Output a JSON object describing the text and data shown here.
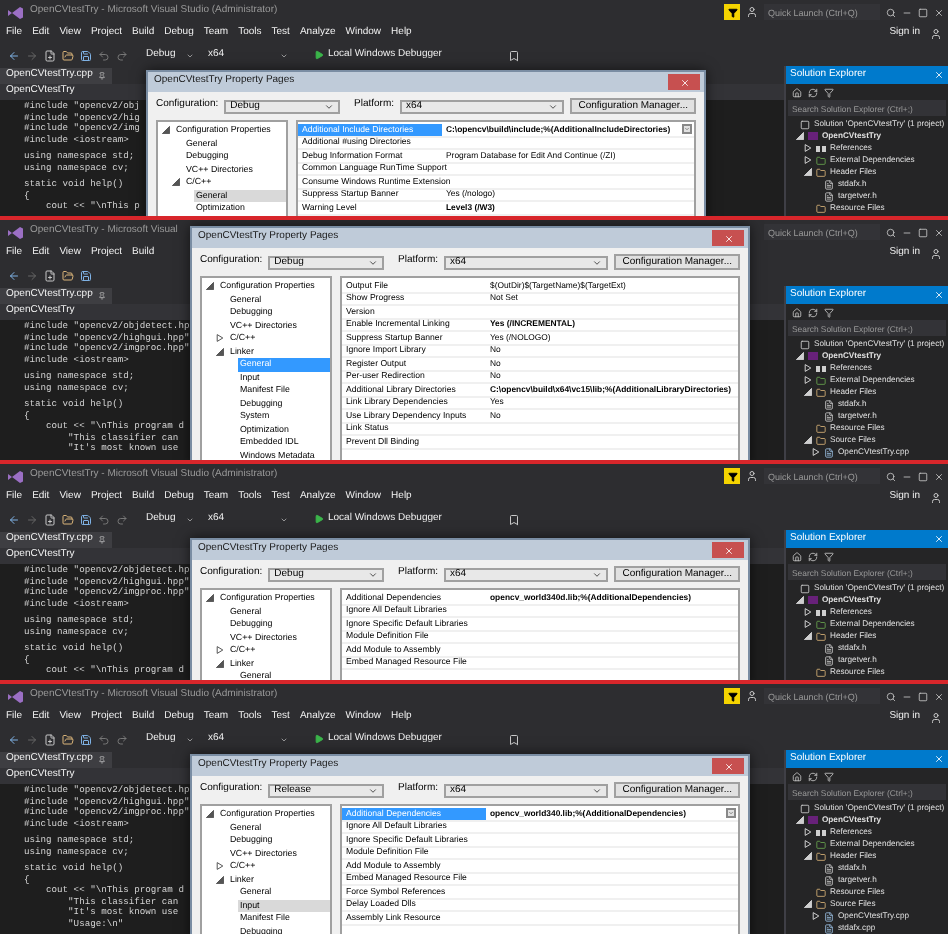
{
  "panels": [
    {
      "title": "OpenCVtestTry - Microsoft Visual Studio (Administrator)",
      "quick_launch": {
        "placeholder": "Quick Launch (Ctrl+Q)"
      },
      "menu": [
        "File",
        "Edit",
        "View",
        "Project",
        "Build",
        "Debug",
        "Team",
        "Tools",
        "Test",
        "Analyze",
        "Window",
        "Help"
      ],
      "sign_in": "Sign in",
      "toolbar": {
        "configuration": "Debug",
        "platform": "x64",
        "debugger": "Local Windows Debugger"
      },
      "editor": {
        "tab": "OpenCVtestTry.cpp",
        "scope": "OpenCVtestTry",
        "code_blocks": [
          [
            "#include \"opencv2/obj",
            "#include \"opencv2/hig",
            "#include \"opencv2/img",
            "#include <iostream>"
          ],
          [
            "using namespace std;",
            "using namespace cv;"
          ],
          [
            "static void help()",
            "{",
            "    cout << \"\\nThis p"
          ]
        ]
      },
      "solution_explorer": {
        "title": "Solution Explorer",
        "search": {
          "placeholder": "Search Solution Explorer (Ctrl+;)"
        },
        "tree": [
          {
            "label": "Solution 'OpenCVtestTry' (1 project)",
            "kind": "solution",
            "children": [
              {
                "label": "OpenCVtestTry",
                "kind": "project",
                "expanded": true,
                "children": [
                  {
                    "label": "References",
                    "kind": "references",
                    "expanded": false
                  },
                  {
                    "label": "External Dependencies",
                    "kind": "dependencies",
                    "expanded": false
                  },
                  {
                    "label": "Header Files",
                    "kind": "folder",
                    "expanded": true,
                    "children": [
                      {
                        "label": "stdafx.h",
                        "kind": "file"
                      },
                      {
                        "label": "targetver.h",
                        "kind": "file"
                      }
                    ]
                  },
                  {
                    "label": "Resource Files",
                    "kind": "folder"
                  }
                ]
              }
            ]
          }
        ]
      },
      "dialog": {
        "title": "OpenCVtestTry Property Pages",
        "configuration_label": "Configuration:",
        "configuration": "Debug",
        "platform_label": "Platform:",
        "platform": "x64",
        "manager_button": "Configuration Manager...",
        "tree_focused": false,
        "tree": [
          {
            "label": "Configuration Properties",
            "expanded": true,
            "selected": false,
            "children": [
              {
                "label": "General",
                "selected": false
              },
              {
                "label": "Debugging",
                "selected": false
              },
              {
                "label": "VC++ Directories",
                "selected": false
              },
              {
                "label": "C/C++",
                "expanded": true,
                "selected": false,
                "children": [
                  {
                    "label": "General",
                    "selected": true
                  },
                  {
                    "label": "Optimization",
                    "selected": false
                  }
                ]
              }
            ]
          }
        ],
        "properties": [
          {
            "name": "Additional Include Directories",
            "value": "C:\\opencv\\build\\include;%(AdditionalIncludeDirectories)",
            "bold": true,
            "selected": true
          },
          {
            "name": "Additional #using Directories",
            "selected": false
          },
          {
            "name": "Debug Information Format",
            "value": "Program Database for Edit And Continue (/ZI)",
            "bold": false,
            "selected": false
          },
          {
            "name": "Common Language RunTime Support",
            "selected": false
          },
          {
            "name": "Consume Windows Runtime Extension",
            "selected": false
          },
          {
            "name": "Suppress Startup Banner",
            "value": "Yes (/nologo)",
            "bold": false,
            "selected": false
          },
          {
            "name": "Warning Level",
            "value": "Level3 (/W3)",
            "bold": true,
            "selected": false
          }
        ]
      }
    },
    {
      "title": "OpenCVtestTry - Microsoft Visual",
      "quick_launch": {
        "placeholder": "Quick Launch (Ctrl+Q)"
      },
      "menu": [
        "File",
        "Edit",
        "View",
        "Project",
        "Build"
      ],
      "sign_in": "Sign in",
      "editor": {
        "tab": "OpenCVtestTry.cpp",
        "scope": "OpenCVtestTry",
        "code_blocks": [
          [
            "#include \"opencv2/objdetect.hp",
            "#include \"opencv2/highgui.hpp\"",
            "#include \"opencv2/imgproc.hpp\"",
            "#include <iostream>"
          ],
          [
            "using namespace std;",
            "using namespace cv;"
          ],
          [
            "static void help()",
            "{",
            "    cout << \"\\nThis program d",
            "        \"This classifier can",
            "        \"It's most known use"
          ]
        ]
      },
      "solution_explorer": {
        "title": "Solution Explorer",
        "search": {
          "placeholder": "Search Solution Explorer (Ctrl+;)"
        },
        "tree": [
          {
            "label": "Solution 'OpenCVtestTry' (1 project)",
            "kind": "solution",
            "children": [
              {
                "label": "OpenCVtestTry",
                "kind": "project",
                "expanded": true,
                "children": [
                  {
                    "label": "References",
                    "kind": "references",
                    "expanded": false
                  },
                  {
                    "label": "External Dependencies",
                    "kind": "dependencies",
                    "expanded": false
                  },
                  {
                    "label": "Header Files",
                    "kind": "folder",
                    "expanded": true,
                    "children": [
                      {
                        "label": "stdafx.h",
                        "kind": "file"
                      },
                      {
                        "label": "targetver.h",
                        "kind": "file"
                      }
                    ]
                  },
                  {
                    "label": "Resource Files",
                    "kind": "folder"
                  },
                  {
                    "label": "Source Files",
                    "kind": "folder",
                    "expanded": true,
                    "children": [
                      {
                        "label": "OpenCVtestTry.cpp",
                        "kind": "source",
                        "expanded": false
                      }
                    ]
                  }
                ]
              }
            ]
          }
        ]
      },
      "dialog": {
        "title": "OpenCVtestTry Property Pages",
        "configuration_label": "Configuration:",
        "configuration": "Debug",
        "platform_label": "Platform:",
        "platform": "x64",
        "manager_button": "Configuration Manager...",
        "tree_focused": true,
        "tree": [
          {
            "label": "Configuration Properties",
            "expanded": true,
            "selected": false,
            "children": [
              {
                "label": "General",
                "selected": false
              },
              {
                "label": "Debugging",
                "selected": false
              },
              {
                "label": "VC++ Directories",
                "selected": false
              },
              {
                "label": "C/C++",
                "expanded": false,
                "selected": false
              },
              {
                "label": "Linker",
                "expanded": true,
                "selected": false,
                "children": [
                  {
                    "label": "General",
                    "selected": true
                  },
                  {
                    "label": "Input",
                    "selected": false
                  },
                  {
                    "label": "Manifest File",
                    "selected": false
                  },
                  {
                    "label": "Debugging",
                    "selected": false
                  },
                  {
                    "label": "System",
                    "selected": false
                  },
                  {
                    "label": "Optimization",
                    "selected": false
                  },
                  {
                    "label": "Embedded IDL",
                    "selected": false
                  },
                  {
                    "label": "Windows Metadata",
                    "selected": false
                  }
                ]
              }
            ]
          }
        ],
        "properties": [
          {
            "name": "Output File",
            "value": "$(OutDir)$(TargetName)$(TargetExt)",
            "bold": false,
            "selected": false
          },
          {
            "name": "Show Progress",
            "value": "Not Set",
            "bold": false,
            "selected": false
          },
          {
            "name": "Version",
            "selected": false
          },
          {
            "name": "Enable Incremental Linking",
            "value": "Yes (/INCREMENTAL)",
            "bold": true,
            "selected": false
          },
          {
            "name": "Suppress Startup Banner",
            "value": "Yes (/NOLOGO)",
            "bold": false,
            "selected": false
          },
          {
            "name": "Ignore Import Library",
            "value": "No",
            "bold": false,
            "selected": false
          },
          {
            "name": "Register Output",
            "value": "No",
            "bold": false,
            "selected": false
          },
          {
            "name": "Per-user Redirection",
            "value": "No",
            "bold": false,
            "selected": false
          },
          {
            "name": "Additional Library Directories",
            "value": "C:\\opencv\\build\\x64\\vc15\\lib;%(AdditionalLibraryDirectories)",
            "bold": true,
            "selected": false
          },
          {
            "name": "Link Library Dependencies",
            "value": "Yes",
            "bold": false,
            "selected": false
          },
          {
            "name": "Use Library Dependency Inputs",
            "value": "No",
            "bold": false,
            "selected": false
          },
          {
            "name": "Link Status",
            "selected": false
          },
          {
            "name": "Prevent Dll Binding",
            "selected": false
          }
        ]
      }
    },
    {
      "title": "OpenCVtestTry - Microsoft Visual Studio (Administrator)",
      "quick_launch": {
        "placeholder": "Quick Launch (Ctrl+Q)"
      },
      "menu": [
        "File",
        "Edit",
        "View",
        "Project",
        "Build",
        "Debug",
        "Team",
        "Tools",
        "Test",
        "Analyze",
        "Window",
        "Help"
      ],
      "sign_in": "Sign in",
      "toolbar": {
        "configuration": "Debug",
        "platform": "x64",
        "debugger": "Local Windows Debugger"
      },
      "editor": {
        "tab": "OpenCVtestTry.cpp",
        "scope": "OpenCVtestTry",
        "code_blocks": [
          [
            "#include \"opencv2/objdetect.hp",
            "#include \"opencv2/highgui.hpp\"",
            "#include \"opencv2/imgproc.hpp\"",
            "#include <iostream>"
          ],
          [
            "using namespace std;",
            "using namespace cv;"
          ],
          [
            "static void help()",
            "{",
            "    cout << \"\\nThis program d"
          ]
        ]
      },
      "solution_explorer": {
        "title": "Solution Explorer",
        "search": {
          "placeholder": "Search Solution Explorer (Ctrl+;)"
        },
        "tree": [
          {
            "label": "Solution 'OpenCVtestTry' (1 project)",
            "kind": "solution",
            "children": [
              {
                "label": "OpenCVtestTry",
                "kind": "project",
                "expanded": true,
                "children": [
                  {
                    "label": "References",
                    "kind": "references",
                    "expanded": false
                  },
                  {
                    "label": "External Dependencies",
                    "kind": "dependencies",
                    "expanded": false
                  },
                  {
                    "label": "Header Files",
                    "kind": "folder",
                    "expanded": true,
                    "children": [
                      {
                        "label": "stdafx.h",
                        "kind": "file"
                      },
                      {
                        "label": "targetver.h",
                        "kind": "file"
                      }
                    ]
                  },
                  {
                    "label": "Resource Files",
                    "kind": "folder"
                  }
                ]
              }
            ]
          }
        ]
      },
      "dialog": {
        "title": "OpenCVtestTry Property Pages",
        "configuration_label": "Configuration:",
        "configuration": "Debug",
        "platform_label": "Platform:",
        "platform": "x64",
        "manager_button": "Configuration Manager...",
        "tree": [
          {
            "label": "Configuration Properties",
            "expanded": true,
            "selected": false,
            "children": [
              {
                "label": "General",
                "selected": false
              },
              {
                "label": "Debugging",
                "selected": false
              },
              {
                "label": "VC++ Directories",
                "selected": false
              },
              {
                "label": "C/C++",
                "expanded": false,
                "selected": false
              },
              {
                "label": "Linker",
                "expanded": true,
                "selected": false,
                "children": [
                  {
                    "label": "General",
                    "selected": false
                  }
                ]
              }
            ]
          }
        ],
        "properties": [
          {
            "name": "Additional Dependencies",
            "value": "opencv_world340d.lib;%(AdditionalDependencies)",
            "bold": true,
            "selected": false
          },
          {
            "name": "Ignore All Default Libraries",
            "selected": false
          },
          {
            "name": "Ignore Specific Default Libraries",
            "selected": false
          },
          {
            "name": "Module Definition File",
            "selected": false
          },
          {
            "name": "Add Module to Assembly",
            "selected": false
          },
          {
            "name": "Embed Managed Resource File",
            "selected": false
          }
        ]
      }
    },
    {
      "title": "OpenCVtestTry - Microsoft Visual Studio (Administrator)",
      "quick_launch": {
        "placeholder": "Quick Launch (Ctrl+Q)"
      },
      "menu": [
        "File",
        "Edit",
        "View",
        "Project",
        "Build",
        "Debug",
        "Team",
        "Tools",
        "Test",
        "Analyze",
        "Window",
        "Help"
      ],
      "sign_in": "Sign in",
      "toolbar": {
        "configuration": "Debug",
        "platform": "x64",
        "debugger": "Local Windows Debugger"
      },
      "editor": {
        "tab": "OpenCVtestTry.cpp",
        "scope": "OpenCVtestTry",
        "code_blocks": [
          [
            "#include \"opencv2/objdetect.hp",
            "#include \"opencv2/highgui.hpp\"",
            "#include \"opencv2/imgproc.hpp\"",
            "#include <iostream>"
          ],
          [
            "using namespace std;",
            "using namespace cv;"
          ],
          [
            "static void help()",
            "{",
            "    cout << \"\\nThis program d",
            "        \"This classifier can",
            "        \"It's most known use",
            "        \"Usage:\\n\""
          ]
        ]
      },
      "solution_explorer": {
        "title": "Solution Explorer",
        "search": {
          "placeholder": "Search Solution Explorer (Ctrl+;)"
        },
        "tree": [
          {
            "label": "Solution 'OpenCVtestTry' (1 project)",
            "kind": "solution",
            "children": [
              {
                "label": "OpenCVtestTry",
                "kind": "project",
                "expanded": true,
                "children": [
                  {
                    "label": "References",
                    "kind": "references",
                    "expanded": false
                  },
                  {
                    "label": "External Dependencies",
                    "kind": "dependencies",
                    "expanded": false
                  },
                  {
                    "label": "Header Files",
                    "kind": "folder",
                    "expanded": true,
                    "children": [
                      {
                        "label": "stdafx.h",
                        "kind": "file"
                      },
                      {
                        "label": "targetver.h",
                        "kind": "file"
                      }
                    ]
                  },
                  {
                    "label": "Resource Files",
                    "kind": "folder"
                  },
                  {
                    "label": "Source Files",
                    "kind": "folder",
                    "expanded": true,
                    "children": [
                      {
                        "label": "OpenCVtestTry.cpp",
                        "kind": "source",
                        "expanded": false
                      },
                      {
                        "label": "stdafx.cpp",
                        "kind": "source"
                      }
                    ]
                  }
                ]
              }
            ]
          }
        ]
      },
      "dialog": {
        "title": "OpenCVtestTry Property Pages",
        "configuration_label": "Configuration:",
        "configuration": "Release",
        "platform_label": "Platform:",
        "platform": "x64",
        "manager_button": "Configuration Manager...",
        "tree_focused": false,
        "tree": [
          {
            "label": "Configuration Properties",
            "expanded": true,
            "selected": false,
            "children": [
              {
                "label": "General",
                "selected": false
              },
              {
                "label": "Debugging",
                "selected": false
              },
              {
                "label": "VC++ Directories",
                "selected": false
              },
              {
                "label": "C/C++",
                "expanded": false,
                "selected": false
              },
              {
                "label": "Linker",
                "expanded": true,
                "selected": false,
                "children": [
                  {
                    "label": "General",
                    "selected": false
                  },
                  {
                    "label": "Input",
                    "selected": true
                  },
                  {
                    "label": "Manifest File",
                    "selected": false
                  },
                  {
                    "label": "Debugging",
                    "selected": false
                  }
                ]
              }
            ]
          }
        ],
        "properties": [
          {
            "name": "Additional Dependencies",
            "value": "opencv_world340.lib;%(AdditionalDependencies)",
            "bold": true,
            "selected": true
          },
          {
            "name": "Ignore All Default Libraries",
            "selected": false
          },
          {
            "name": "Ignore Specific Default Libraries",
            "selected": false
          },
          {
            "name": "Module Definition File",
            "selected": false
          },
          {
            "name": "Add Module to Assembly",
            "selected": false
          },
          {
            "name": "Embed Managed Resource File",
            "selected": false
          },
          {
            "name": "Force Symbol References",
            "selected": false
          },
          {
            "name": "Delay Loaded Dlls",
            "selected": false
          },
          {
            "name": "Assembly Link Resource",
            "selected": false
          }
        ]
      }
    }
  ]
}
